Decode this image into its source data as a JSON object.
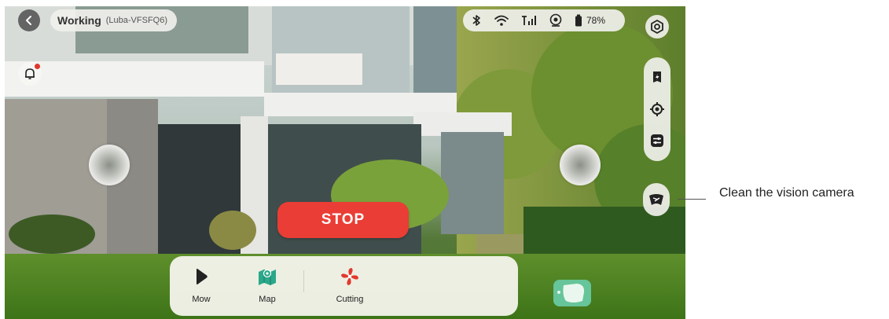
{
  "status": {
    "main": "Working",
    "device": "(Luba-VFSFQ6)"
  },
  "system": {
    "battery": "78%",
    "icons": [
      "bluetooth-icon",
      "wifi-icon",
      "cellular-icon",
      "gnss-icon",
      "battery-icon"
    ]
  },
  "controls": {
    "stop_label": "STOP"
  },
  "bottom_bar": {
    "items": [
      {
        "label": "Mow",
        "icon": "play-icon"
      },
      {
        "label": "Map",
        "icon": "map-icon"
      },
      {
        "label": "Cutting",
        "icon": "fan-icon"
      }
    ]
  },
  "right_tools": [
    "flash-card-icon",
    "locate-icon",
    "sliders-icon"
  ],
  "annotation": {
    "clean_camera": "Clean the vision camera"
  },
  "colors": {
    "stop": "#ea3d35",
    "map_teal": "#2aa88a",
    "minimap": "#66c59a"
  }
}
